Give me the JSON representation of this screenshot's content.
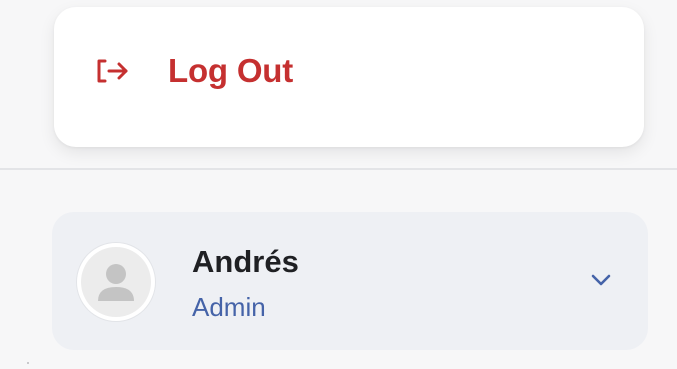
{
  "menu": {
    "logout_label": "Log Out",
    "logout_icon": "logout-icon",
    "accent_color": "#c53030"
  },
  "user": {
    "name": "Andrés",
    "role": "Admin",
    "avatar_icon": "user-placeholder-icon",
    "expand_icon": "chevron-down-icon",
    "role_color": "#4563a8"
  }
}
